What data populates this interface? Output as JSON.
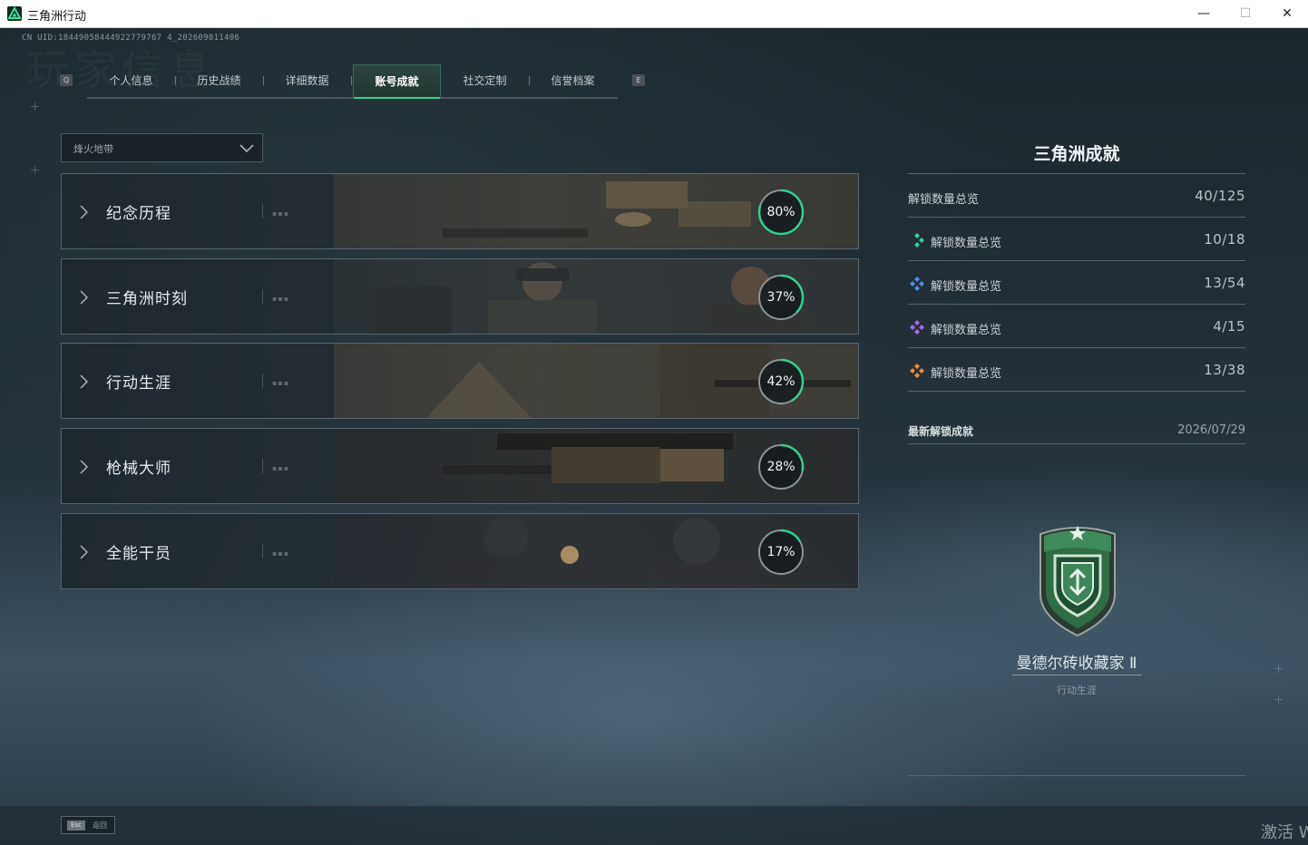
{
  "window": {
    "title": "三角洲行动",
    "minimize_glyph": "—",
    "maximize_glyph": "☐",
    "close_glyph": "✕"
  },
  "header": {
    "uid": "CN UID:18449058444922779767 4_202609011406",
    "background_title": "玩家信息"
  },
  "tabs": {
    "prev_key": "Q",
    "next_key": "E",
    "items": [
      {
        "label": "个人信息"
      },
      {
        "label": "历史战绩"
      },
      {
        "label": "详细数据"
      },
      {
        "label": "账号成就",
        "active": true
      },
      {
        "label": "社交定制"
      },
      {
        "label": "信誉档案"
      }
    ]
  },
  "filter": {
    "selected": "烽火地带"
  },
  "categories": [
    {
      "name": "纪念历程",
      "progress_percent": 80,
      "progress_text": "80%"
    },
    {
      "name": "三角洲时刻",
      "progress_percent": 37,
      "progress_text": "37%"
    },
    {
      "name": "行动生涯",
      "progress_percent": 42,
      "progress_text": "42%"
    },
    {
      "name": "枪械大师",
      "progress_percent": 28,
      "progress_text": "28%"
    },
    {
      "name": "全能干员",
      "progress_percent": 17,
      "progress_text": "17%"
    }
  ],
  "summary": {
    "title": "三角洲成就",
    "total": {
      "label": "解锁数量总览",
      "value": "40/125"
    },
    "tiers": [
      {
        "label": "解锁数量总览",
        "value": "10/18",
        "icon": "green-tier-icon",
        "color": "#2fd39a"
      },
      {
        "label": "解锁数量总览",
        "value": "13/54",
        "icon": "blue-tier-icon",
        "color": "#4e8fe0"
      },
      {
        "label": "解锁数量总览",
        "value": "4/15",
        "icon": "purple-tier-icon",
        "color": "#b067e6"
      },
      {
        "label": "解锁数量总览",
        "value": "13/38",
        "icon": "orange-tier-icon",
        "color": "#e88a3c"
      }
    ]
  },
  "latest": {
    "label": "最新解锁成就",
    "date": "2026/07/29",
    "achievement_name": "曼德尔砖收藏家 Ⅱ",
    "achievement_category": "行动生涯"
  },
  "footer": {
    "esc_key": "Esc",
    "back_label": "返回",
    "activate_text": "激活 W"
  },
  "colors": {
    "accent_green": "#2cd48c"
  }
}
